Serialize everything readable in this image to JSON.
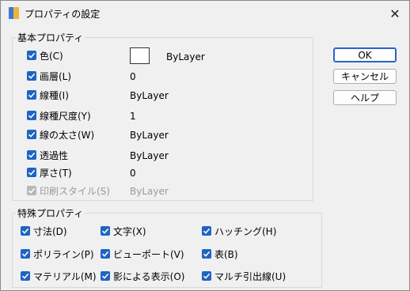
{
  "window": {
    "title": "プロパティの設定"
  },
  "buttons": {
    "ok": "OK",
    "cancel": "キャンセル",
    "help": "ヘルプ"
  },
  "basic": {
    "group_label": "基本プロパティ",
    "items": [
      {
        "label": "色(C)",
        "value": "ByLayer",
        "checked": true,
        "enabled": true
      },
      {
        "label": "画層(L)",
        "value": "0",
        "checked": true,
        "enabled": true
      },
      {
        "label": "線種(I)",
        "value": "ByLayer",
        "checked": true,
        "enabled": true
      },
      {
        "label": "線種尺度(Y)",
        "value": "1",
        "checked": true,
        "enabled": true
      },
      {
        "label": "線の太さ(W)",
        "value": "ByLayer",
        "checked": true,
        "enabled": true
      },
      {
        "label": "透過性",
        "value": "ByLayer",
        "checked": true,
        "enabled": true
      },
      {
        "label": "厚さ(T)",
        "value": "0",
        "checked": true,
        "enabled": true
      },
      {
        "label": "印刷スタイル(S)",
        "value": "ByLayer",
        "checked": true,
        "enabled": false
      }
    ]
  },
  "special": {
    "group_label": "特殊プロパティ",
    "items": [
      {
        "label": "寸法(D)",
        "checked": true
      },
      {
        "label": "文字(X)",
        "checked": true
      },
      {
        "label": "ハッチング(H)",
        "checked": true
      },
      {
        "label": "ポリライン(P)",
        "checked": true
      },
      {
        "label": "ビューポート(V)",
        "checked": true
      },
      {
        "label": "表(B)",
        "checked": true
      },
      {
        "label": "マテリアル(M)",
        "checked": true
      },
      {
        "label": "影による表示(O)",
        "checked": true
      },
      {
        "label": "マルチ引出線(U)",
        "checked": true
      }
    ]
  },
  "colors": {
    "accent": "#1f64c4",
    "disabled": "#9a9a9a"
  }
}
